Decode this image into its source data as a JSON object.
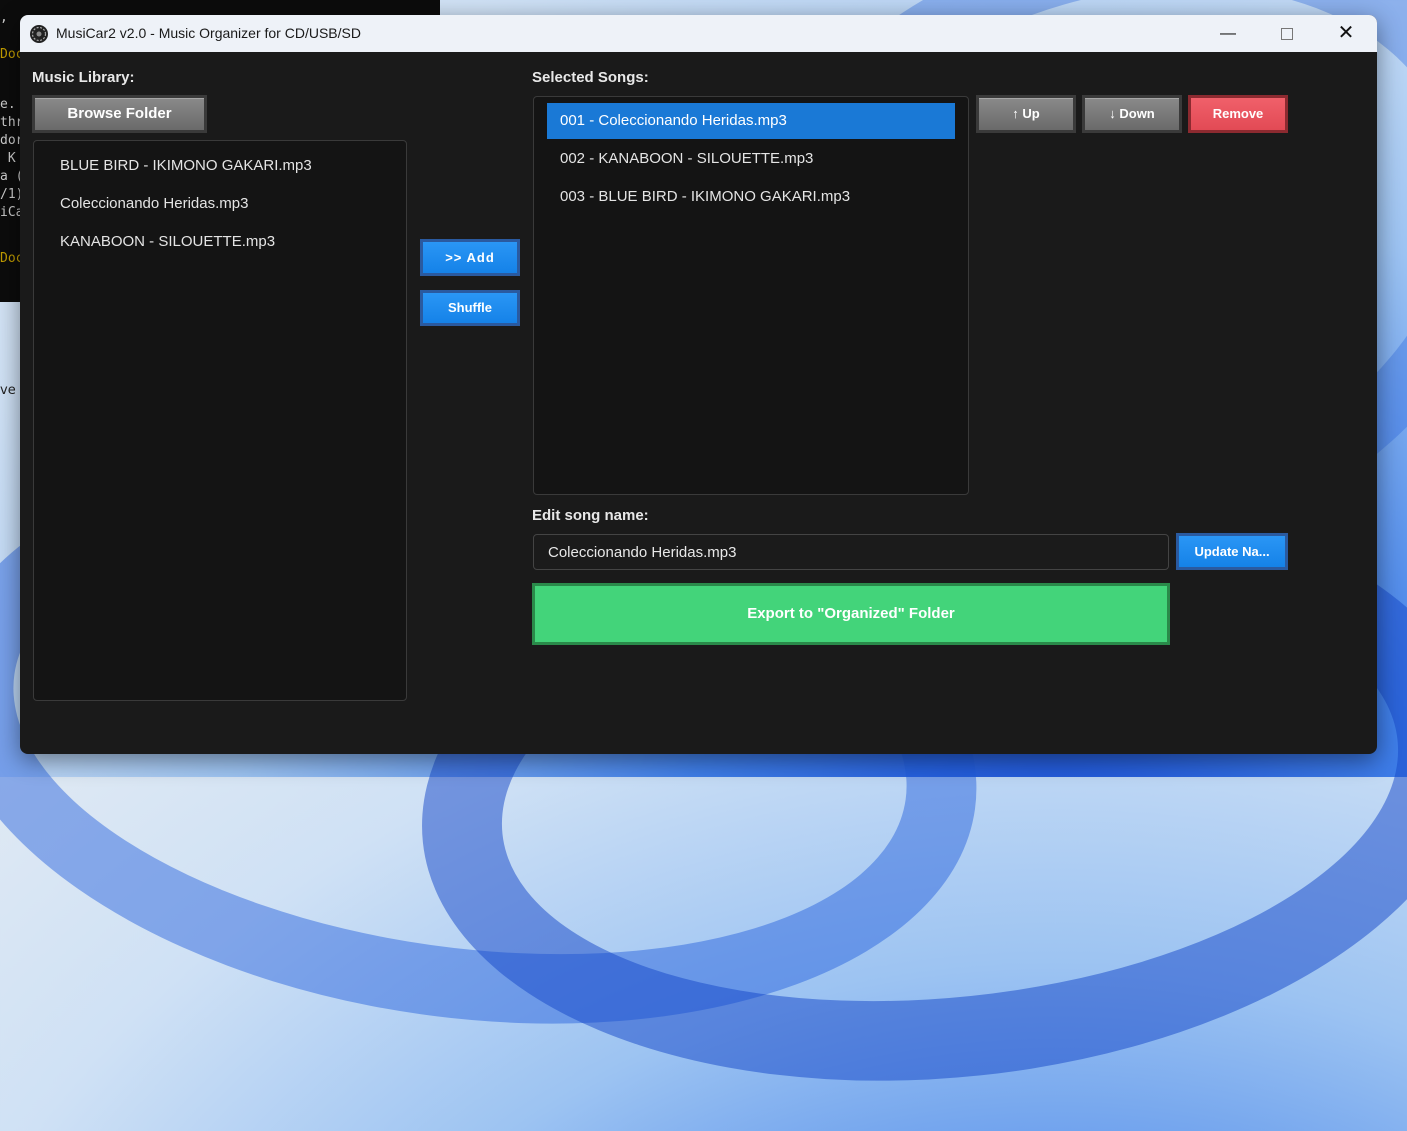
{
  "desktop": {
    "terminal_lines": [
      ", ",
      "Doc",
      "e.",
      "thr",
      "dor",
      " K",
      "a (",
      "/1)",
      "iCa",
      "Doc"
    ],
    "fragment": "ve"
  },
  "window": {
    "title": "MusiCar2 v2.0 - Music Organizer for CD/USB/SD",
    "controls": {
      "minimize": "—",
      "close": "✕"
    }
  },
  "library": {
    "label": "Music Library:",
    "browse_label": "Browse Folder",
    "items": [
      "BLUE BIRD - IKIMONO GAKARI.mp3",
      "Coleccionando Heridas.mp3",
      "KANABOON - SILOUETTE.mp3"
    ]
  },
  "middle": {
    "add_label": ">> Add",
    "shuffle_label": "Shuffle"
  },
  "selected": {
    "label": "Selected Songs:",
    "items": [
      "001 - Coleccionando Heridas.mp3",
      "002 - KANABOON - SILOUETTE.mp3",
      "003 - BLUE BIRD - IKIMONO GAKARI.mp3"
    ],
    "up_label": "↑ Up",
    "down_label": "↓ Down",
    "remove_label": "Remove"
  },
  "edit": {
    "label": "Edit song name:",
    "value": "Coleccionando Heridas.mp3",
    "update_label": "Update Na..."
  },
  "export": {
    "label": "Export to \"Organized\" Folder"
  },
  "colors": {
    "accent_blue": "#1582e8",
    "selection": "#1a79d6",
    "remove_red": "#e24a55",
    "export_green": "#43d47a",
    "window_bg": "#1a1a1a"
  }
}
